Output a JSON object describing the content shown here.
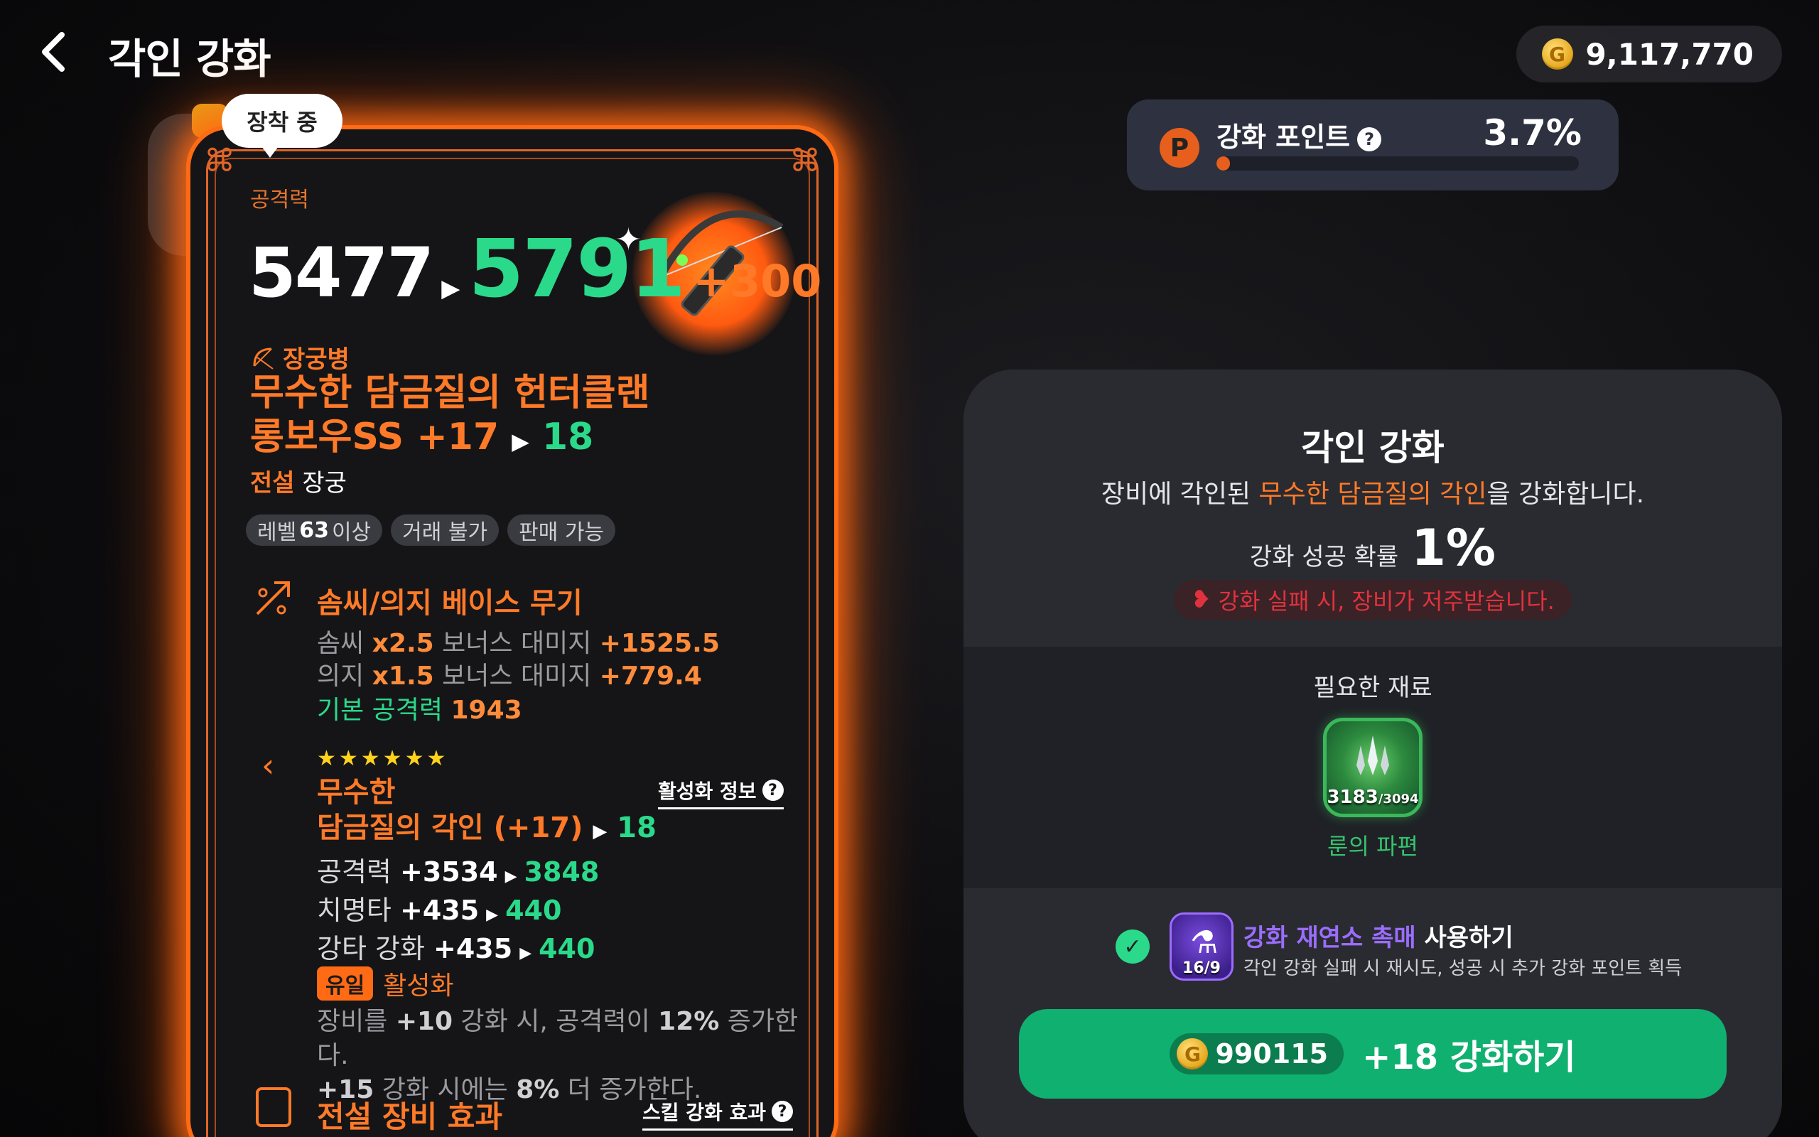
{
  "header": {
    "title": "각인 강화",
    "gold": "9,117,770"
  },
  "points": {
    "badge": "P",
    "label": "강화 포인트",
    "percent_text": "3.7%",
    "fill_fraction": 0.037
  },
  "item": {
    "equipped_tag": "장착 중",
    "attack_label": "공격력",
    "attack_old": "5477",
    "attack_new": "5791",
    "attack_bonus": "+300",
    "class": "장궁병",
    "name_line1": "무수한 담금질의 헌터클랜",
    "name_line2": "롱보우SS +17",
    "name_next": "18",
    "grade": "전설",
    "type": "장궁",
    "chips": {
      "level_prefix": "레벨",
      "level_value": "63",
      "level_suffix": "이상",
      "trade": "거래 불가",
      "sell": "판매 가능"
    },
    "base_section": {
      "title": "솜씨/의지 베이스 무기",
      "l1_stat": "솜씨",
      "l1_mult": "x2.5",
      "l1_mid": "보너스 대미지",
      "l1_val": "+1525.5",
      "l2_stat": "의지",
      "l2_mult": "x1.5",
      "l2_mid": "보너스 대미지",
      "l2_val": "+779.4",
      "l3_label": "기본 공격력",
      "l3_val": "1943"
    },
    "engraving": {
      "stars": "★★★★★★",
      "info_link": "활성화 정보",
      "name_line1": "무수한",
      "name_line2": "담금질의 각인 (+17)",
      "name_next": "18",
      "stats": [
        {
          "label": "공격력",
          "old": "+3534",
          "new": "3848"
        },
        {
          "label": "치명타",
          "old": "+435",
          "new": "440"
        },
        {
          "label": "강타 강화",
          "old": "+435",
          "new": "440"
        }
      ],
      "unique_badge": "유일",
      "unique_label": "활성화",
      "desc_1a": "장비를",
      "desc_1b": "+10",
      "desc_1c": "강화 시, 공격력이",
      "desc_1d": "12%",
      "desc_1e": "증가한다.",
      "desc_2a": "+15",
      "desc_2b": "강화 시에는",
      "desc_2c": "8%",
      "desc_2d": "더 증가한다."
    },
    "legend_section": {
      "title": "전설 장비 효과",
      "skill_link": "스킬 강화 효과"
    }
  },
  "panel": {
    "title": "각인 강화",
    "sub_a": "장비에 각인된",
    "sub_b": "무수한 담금질의 각인",
    "sub_c": "을 강화합니다.",
    "rate_label": "강화 성공 확률",
    "rate_value": "1%",
    "warning": "강화 실패 시, 장비가 저주받습니다.",
    "materials_title": "필요한 재료",
    "material": {
      "owned": "3183",
      "required": "/3094",
      "name": "룬의 파편",
      "icon": "crystal-icon"
    },
    "catalyst": {
      "count": "16/9",
      "title_a": "강화 재연소 촉매",
      "title_b": "사용하기",
      "desc": "각인 강화 실패 시 재시도, 성공 시 추가 강화 포인트 획득",
      "checked": true
    },
    "button": {
      "cost": "990115",
      "label": "+18 강화하기"
    }
  },
  "colors": {
    "accent_orange": "#ff7a28",
    "accent_green": "#2bd98a",
    "button_green": "#10b070",
    "warn_red": "#e0323e",
    "catalyst_purple": "#9b6dff"
  }
}
